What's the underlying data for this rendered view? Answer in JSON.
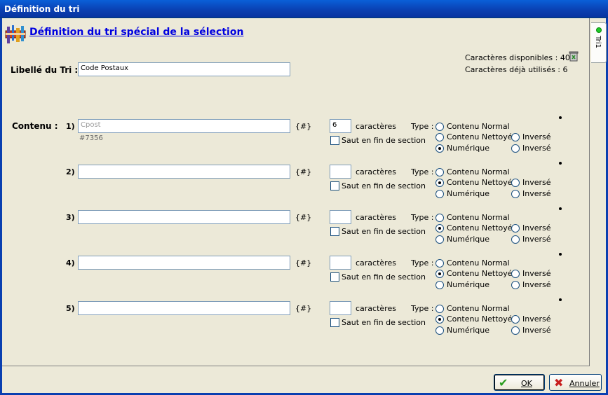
{
  "window": {
    "title": "Définition du tri"
  },
  "header": {
    "link_text": "Définition du tri spécial de la sélection"
  },
  "side_tab": {
    "label": "Tri1"
  },
  "info": {
    "available": "Caractères disponibles : 40",
    "used": "Caractères déjà utilisés : 6"
  },
  "libelle": {
    "label": "Libellé du Tri :",
    "value": "Code Postaux"
  },
  "contenu_label": "Contenu :",
  "common": {
    "hash": "{#}",
    "caracteres": "caractères",
    "saut": "Saut en fin de section",
    "type": "Type :",
    "contenu_normal": "Contenu Normal",
    "contenu_nettoye": "Contenu Nettoyé",
    "numerique": "Numérique",
    "inverse": "Inversé"
  },
  "rows": [
    {
      "num": "1)",
      "field": "Cpost",
      "sub": "#7356",
      "chars": "6",
      "type_selected": "numerique"
    },
    {
      "num": "2)",
      "field": "",
      "sub": "",
      "chars": "",
      "type_selected": "contenu_nettoye"
    },
    {
      "num": "3)",
      "field": "",
      "sub": "",
      "chars": "",
      "type_selected": "contenu_nettoye"
    },
    {
      "num": "4)",
      "field": "",
      "sub": "",
      "chars": "",
      "type_selected": "contenu_nettoye"
    },
    {
      "num": "5)",
      "field": "",
      "sub": "",
      "chars": "",
      "type_selected": "contenu_nettoye"
    }
  ],
  "buttons": {
    "ok": "OK",
    "annuler": "Annuler"
  },
  "colors": {
    "titlebar": "#0a3fb0",
    "link": "#0000e0",
    "background": "#ece9d8",
    "ok_icon": "#2a9d1f",
    "cancel_icon": "#c81e1e"
  },
  "icons": {
    "header": "sort-definition-icon",
    "trash": "trash-icon",
    "tab_status": "green-dot-icon"
  }
}
